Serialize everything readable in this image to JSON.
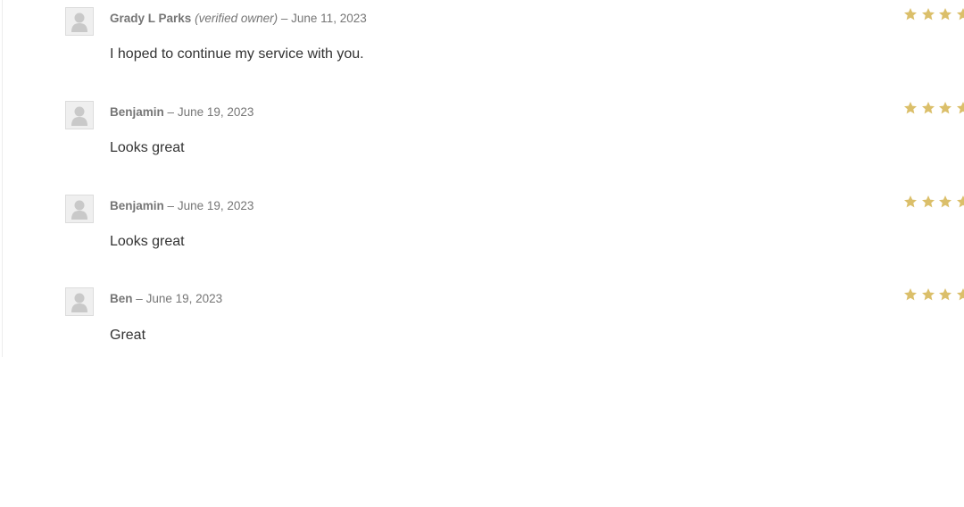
{
  "reviews": [
    {
      "author": "Grady L Parks",
      "verified": "(verified owner)",
      "separator": "–",
      "date": "June 11, 2023",
      "text": "I hoped to continue my service with you."
    },
    {
      "author": "Benjamin",
      "verified": "",
      "separator": "–",
      "date": "June 19, 2023",
      "text": "Looks great"
    },
    {
      "author": "Benjamin",
      "verified": "",
      "separator": "–",
      "date": "June 19, 2023",
      "text": "Looks great"
    },
    {
      "author": "Ben",
      "verified": "",
      "separator": "–",
      "date": "June 19, 2023",
      "text": "Great"
    }
  ],
  "icons": {
    "avatar": "user-placeholder-icon",
    "star": "star-icon"
  },
  "colors": {
    "star": "#dbbf6a",
    "meta_text": "#767676",
    "body_text": "#333333",
    "avatar_bg": "#efefef",
    "avatar_figure": "#c9c9c9"
  }
}
